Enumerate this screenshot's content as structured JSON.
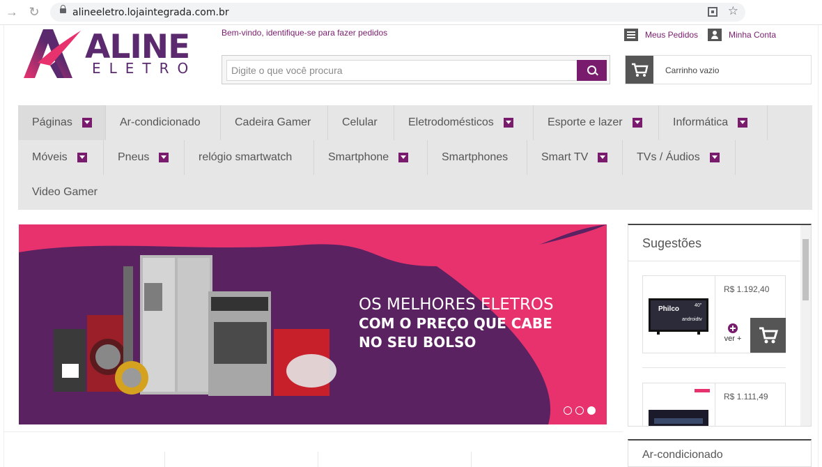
{
  "browser": {
    "url": "alineeletro.lojaintegrada.com.br",
    "back_icon": "arrow-right-icon",
    "reload_icon": "reload-icon"
  },
  "header": {
    "logo_top": "ALINE",
    "logo_bottom": "ELETRO",
    "welcome_text": "Bem-vindo, identifique-se para fazer pedidos",
    "orders_label": "Meus Pedidos",
    "account_label": "Minha Conta",
    "search_placeholder": "Digite o que você procura",
    "cart_label": "Carrinho vazio"
  },
  "menu": {
    "items": [
      {
        "label": "Páginas",
        "dropdown": true
      },
      {
        "label": "Ar-condicionado",
        "dropdown": false
      },
      {
        "label": "Cadeira Gamer",
        "dropdown": false
      },
      {
        "label": "Celular",
        "dropdown": false
      },
      {
        "label": "Eletrodomésticos",
        "dropdown": true
      },
      {
        "label": "Esporte e lazer",
        "dropdown": true
      },
      {
        "label": "Informática",
        "dropdown": true
      },
      {
        "label": "Móveis",
        "dropdown": true
      },
      {
        "label": "Pneus",
        "dropdown": true
      },
      {
        "label": "relógio smartwatch",
        "dropdown": false
      },
      {
        "label": "Smartphone",
        "dropdown": true
      },
      {
        "label": "Smartphones",
        "dropdown": false
      },
      {
        "label": "Smart TV",
        "dropdown": true
      },
      {
        "label": "TVs / Áudios",
        "dropdown": true
      },
      {
        "label": "Video Gamer",
        "dropdown": false
      }
    ]
  },
  "banner": {
    "line1": "OS MELHORES ELETROS",
    "line2": "COM O PREÇO QUE CABE",
    "line3": "NO SEU BOLSO",
    "slides": 3,
    "active_slide": 3
  },
  "sidebar": {
    "suggestions_title": "Sugestões",
    "products": [
      {
        "price": "R$ 1.192,40",
        "tv_brand": "Philco",
        "tv_size": "40\"",
        "tv_os": "androidtv"
      },
      {
        "price": "R$ 1.111,49"
      }
    ],
    "more_label": "ver +",
    "next_section": "Ar-condicionado"
  },
  "colors": {
    "brand": "#7a1c6e",
    "logo": "#5b2a6e",
    "banner_pink": "#e8326e",
    "banner_purple": "#5b2262"
  }
}
